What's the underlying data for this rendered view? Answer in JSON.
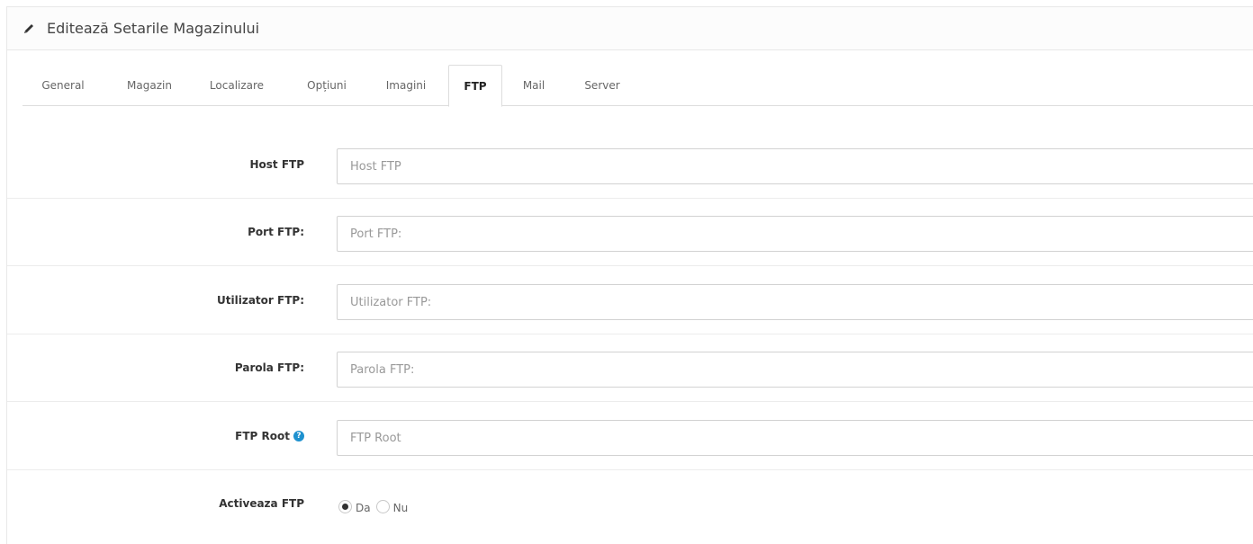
{
  "header": {
    "title": "Editează Setarile Magazinului",
    "icon": "pencil-icon"
  },
  "tabs": [
    {
      "label": "General",
      "active": false
    },
    {
      "label": "Magazin",
      "active": false
    },
    {
      "label": "Localizare",
      "active": false
    },
    {
      "label": "Opțiuni",
      "active": false
    },
    {
      "label": "Imagini",
      "active": false
    },
    {
      "label": "FTP",
      "active": true
    },
    {
      "label": "Mail",
      "active": false
    },
    {
      "label": "Server",
      "active": false
    }
  ],
  "form": {
    "host": {
      "label": "Host FTP",
      "value": "",
      "placeholder": "Host FTP"
    },
    "port": {
      "label": "Port FTP:",
      "value": "",
      "placeholder": "Port FTP:"
    },
    "user": {
      "label": "Utilizator FTP:",
      "value": "",
      "placeholder": "Utilizator FTP:"
    },
    "password": {
      "label": "Parola FTP:",
      "value": "",
      "placeholder": "Parola FTP:"
    },
    "root": {
      "label": "FTP Root",
      "value": "",
      "placeholder": "FTP Root",
      "help_icon": "question-circle-icon"
    },
    "enable": {
      "label": "Activeaza FTP",
      "options": [
        {
          "label": "Da",
          "checked": true
        },
        {
          "label": "Nu",
          "checked": false
        }
      ]
    }
  },
  "colors": {
    "accent": "#1e91cf",
    "border": "#dddddd"
  }
}
